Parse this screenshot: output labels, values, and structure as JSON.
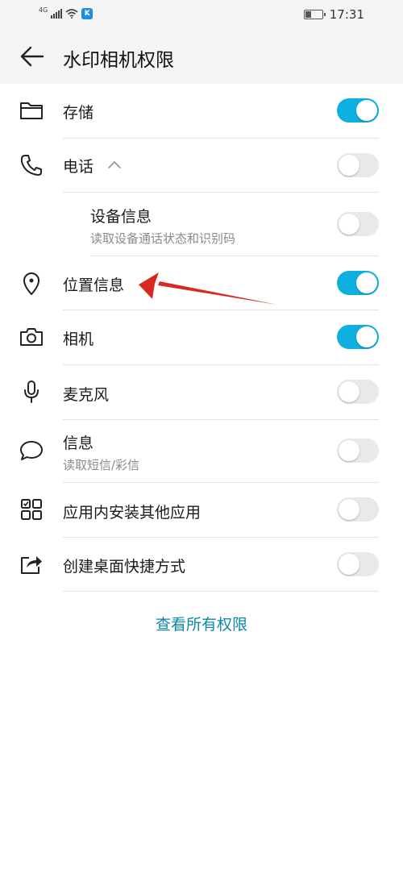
{
  "status_bar": {
    "network": "4G",
    "time": "17:31",
    "battery_level_percent": 40
  },
  "header": {
    "title": "水印相机权限"
  },
  "permissions": [
    {
      "id": "storage",
      "label": "存储",
      "icon": "folder-icon",
      "enabled": true
    },
    {
      "id": "phone",
      "label": "电话",
      "icon": "phone-icon",
      "enabled": false,
      "expanded": true
    },
    {
      "id": "device-info",
      "label": "设备信息",
      "subtitle": "读取设备通话状态和识别码",
      "enabled": false
    },
    {
      "id": "location",
      "label": "位置信息",
      "icon": "location-pin-icon",
      "enabled": true
    },
    {
      "id": "camera",
      "label": "相机",
      "icon": "camera-icon",
      "enabled": true
    },
    {
      "id": "microphone",
      "label": "麦克风",
      "icon": "microphone-icon",
      "enabled": false
    },
    {
      "id": "sms",
      "label": "信息",
      "subtitle": "读取短信/彩信",
      "icon": "chat-bubble-icon",
      "enabled": false
    },
    {
      "id": "install-apps",
      "label": "应用内安装其他应用",
      "icon": "app-grid-icon",
      "enabled": false
    },
    {
      "id": "shortcut",
      "label": "创建桌面快捷方式",
      "icon": "share-shortcut-icon",
      "enabled": false
    }
  ],
  "footer": {
    "view_all_label": "查看所有权限"
  },
  "colors": {
    "toggle_on": "#0eb0e0",
    "toggle_off": "#e9e9e9",
    "link": "#0a8aa8",
    "annotation_arrow": "#d92a22"
  }
}
